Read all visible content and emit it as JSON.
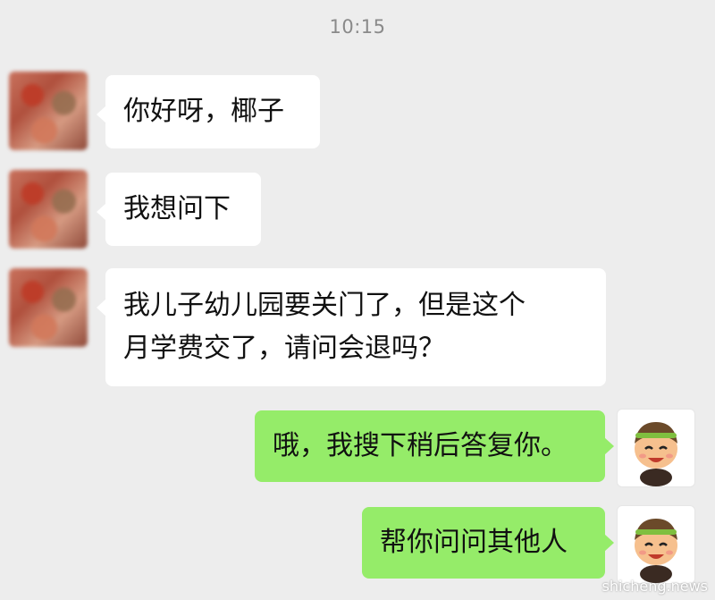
{
  "chat": {
    "timestamp": "10:15",
    "messages": [
      {
        "side": "left",
        "text": "你好呀，椰子"
      },
      {
        "side": "left",
        "text": "我想问下"
      },
      {
        "side": "left",
        "lines": [
          "我儿子幼儿园要关门了，但是这个",
          "月学费交了，请问会退吗？"
        ]
      },
      {
        "side": "right",
        "text": "哦，我搜下稍后答复你。"
      },
      {
        "side": "right",
        "text": "帮你问问其他人"
      }
    ]
  },
  "watermark": "shicheng.news",
  "colors": {
    "background": "#ededed",
    "incoming_bubble": "#ffffff",
    "outgoing_bubble": "#95ec69",
    "timestamp_text": "#8a8a8a"
  },
  "icons": {
    "incoming_avatar": "blurred-avatar",
    "outgoing_avatar": "cartoon-boy-avatar"
  }
}
